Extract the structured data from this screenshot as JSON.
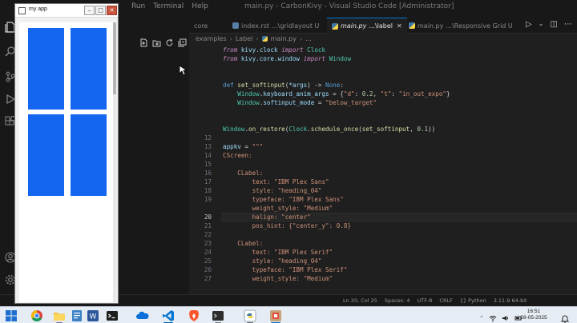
{
  "vscode": {
    "menu": [
      "Run",
      "Terminal",
      "Help"
    ],
    "window_title": "main.py - CarbonKivy - Visual Studio Code [Administrator]",
    "tabs": [
      {
        "label": "core",
        "state": "inactive"
      },
      {
        "label": "index.rst",
        "suffix": "...\\gridlayout U",
        "state": "inactive"
      },
      {
        "label": "main.py",
        "suffix": "...\\label",
        "state": "active"
      },
      {
        "label": "main.py",
        "suffix": "...\\Responsive Grid U",
        "state": "inactive"
      }
    ],
    "breadcrumb": [
      "examples",
      "Label",
      "main.py",
      "..."
    ],
    "code_lines": [
      {
        "n": "",
        "tokens": [
          {
            "c": "kw it",
            "t": "from "
          },
          {
            "c": "vr",
            "t": "kivy.clock "
          },
          {
            "c": "kw it",
            "t": "import "
          },
          {
            "c": "cls",
            "t": "Clock"
          }
        ]
      },
      {
        "n": "",
        "tokens": [
          {
            "c": "kw it",
            "t": "from "
          },
          {
            "c": "vr",
            "t": "kivy.core.window "
          },
          {
            "c": "kw it",
            "t": "import "
          },
          {
            "c": "cls",
            "t": "Window"
          }
        ]
      },
      {
        "n": "",
        "tokens": []
      },
      {
        "n": "",
        "tokens": []
      },
      {
        "n": "",
        "tokens": [
          {
            "c": "df",
            "t": "def "
          },
          {
            "c": "fn",
            "t": "set_softinput"
          },
          {
            "c": "pl",
            "t": "("
          },
          {
            "c": "vr",
            "t": "*args"
          },
          {
            "c": "pl",
            "t": ") -> "
          },
          {
            "c": "df",
            "t": "None"
          },
          {
            "c": "pl",
            "t": ":"
          }
        ]
      },
      {
        "n": "",
        "tokens": [
          {
            "c": "pl",
            "t": "    "
          },
          {
            "c": "cls",
            "t": "Window"
          },
          {
            "c": "pl",
            "t": "."
          },
          {
            "c": "vr",
            "t": "keyboard_anim_args"
          },
          {
            "c": "pl",
            "t": " = {"
          },
          {
            "c": "st",
            "t": "\"d\""
          },
          {
            "c": "pl",
            "t": ": "
          },
          {
            "c": "nm",
            "t": "0.2"
          },
          {
            "c": "pl",
            "t": ", "
          },
          {
            "c": "st",
            "t": "\"t\""
          },
          {
            "c": "pl",
            "t": ": "
          },
          {
            "c": "st",
            "t": "\"in_out_expo\""
          },
          {
            "c": "pl",
            "t": "}"
          }
        ]
      },
      {
        "n": "",
        "tokens": [
          {
            "c": "pl",
            "t": "    "
          },
          {
            "c": "cls",
            "t": "Window"
          },
          {
            "c": "pl",
            "t": "."
          },
          {
            "c": "vr",
            "t": "softinput_mode"
          },
          {
            "c": "pl",
            "t": " = "
          },
          {
            "c": "st",
            "t": "\"below_target\""
          }
        ]
      },
      {
        "n": "",
        "tokens": []
      },
      {
        "n": "",
        "tokens": []
      },
      {
        "n": "",
        "tokens": [
          {
            "c": "cls",
            "t": "Window"
          },
          {
            "c": "pl",
            "t": "."
          },
          {
            "c": "fn",
            "t": "on_restore"
          },
          {
            "c": "pl",
            "t": "("
          },
          {
            "c": "cls",
            "t": "Clock"
          },
          {
            "c": "pl",
            "t": "."
          },
          {
            "c": "fn",
            "t": "schedule_once"
          },
          {
            "c": "pl",
            "t": "("
          },
          {
            "c": "fn",
            "t": "set_softinput"
          },
          {
            "c": "pl",
            "t": ", "
          },
          {
            "c": "nm",
            "t": "0.1"
          },
          {
            "c": "pl",
            "t": "))"
          }
        ]
      },
      {
        "n": "12",
        "tokens": []
      },
      {
        "n": "13",
        "tokens": [
          {
            "c": "vr",
            "t": "appkv"
          },
          {
            "c": "pl",
            "t": " = "
          },
          {
            "c": "st",
            "t": "\"\"\""
          }
        ]
      },
      {
        "n": "14",
        "tokens": [
          {
            "c": "st",
            "t": "CScreen:"
          }
        ]
      },
      {
        "n": "15",
        "tokens": []
      },
      {
        "n": "16",
        "tokens": [
          {
            "c": "st",
            "t": "    CLabel:"
          }
        ]
      },
      {
        "n": "17",
        "tokens": [
          {
            "c": "st",
            "t": "        text: \"IBM Plex Sans\""
          }
        ]
      },
      {
        "n": "18",
        "tokens": [
          {
            "c": "st",
            "t": "        style: \"heading_04\""
          }
        ]
      },
      {
        "n": "19",
        "tokens": [
          {
            "c": "st",
            "t": "        typeface: \"IBM Plex Sans\""
          }
        ]
      },
      {
        "n": "",
        "tokens": [
          {
            "c": "st",
            "t": "        weight_style: \"Medium\""
          }
        ]
      },
      {
        "n": "20",
        "tokens": [
          {
            "c": "st",
            "t": "        halign: \"center\""
          }
        ],
        "current": true
      },
      {
        "n": "21",
        "tokens": [
          {
            "c": "st",
            "t": "        pos_hint: {\"center_y\": 0.8}"
          }
        ]
      },
      {
        "n": "22",
        "tokens": []
      },
      {
        "n": "23",
        "tokens": [
          {
            "c": "st",
            "t": "    CLabel:"
          }
        ]
      },
      {
        "n": "24",
        "tokens": [
          {
            "c": "st",
            "t": "        text: \"IBM Plex Serif\""
          }
        ]
      },
      {
        "n": "25",
        "tokens": [
          {
            "c": "st",
            "t": "        style: \"heading_04\""
          }
        ]
      },
      {
        "n": "26",
        "tokens": [
          {
            "c": "st",
            "t": "        typeface: \"IBM Plex Serif\""
          }
        ]
      },
      {
        "n": "27",
        "tokens": [
          {
            "c": "st",
            "t": "        weight_style: \"Medium\""
          }
        ]
      }
    ],
    "status_right": [
      "Ln 20, Col 25",
      "Spaces: 4",
      "UTF-8",
      "CRLF",
      "{} Python",
      "3.11.9 64-bit"
    ]
  },
  "kivy_window": {
    "title": "my app",
    "btn_minimize": "–",
    "btn_maximize": "□",
    "btn_close": "✕",
    "tile_color": "#1466f0"
  },
  "taskbar": {
    "time": "16:51",
    "date": "28-05-2025"
  },
  "colors": {
    "vscode_bg": "#1f1f1f",
    "accent": "#0078d4",
    "tile_blue": "#1466f0"
  }
}
